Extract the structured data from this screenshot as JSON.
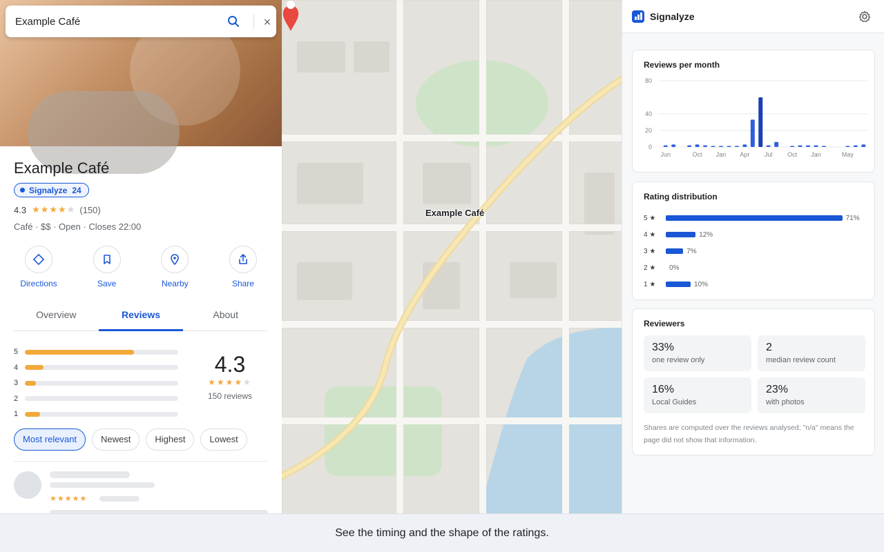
{
  "search": {
    "value": "Example Café",
    "icons": {
      "search": "search-icon",
      "close": "close-icon"
    }
  },
  "place": {
    "name": "Example Café",
    "badge": {
      "label": "Signalyze",
      "count": "24"
    },
    "rating": "4.3",
    "stars": 4,
    "rating_count": "(150)",
    "info": "Café · $$ · Open · Closes 22:00"
  },
  "actions": [
    {
      "label": "Directions",
      "icon": "directions-icon"
    },
    {
      "label": "Save",
      "icon": "bookmark-icon"
    },
    {
      "label": "Nearby",
      "icon": "location-pin-icon"
    },
    {
      "label": "Share",
      "icon": "share-icon"
    }
  ],
  "tabs": [
    {
      "label": "Overview",
      "active": false
    },
    {
      "label": "Reviews",
      "active": true
    },
    {
      "label": "About",
      "active": false
    }
  ],
  "reviews_summary": {
    "histogram": [
      {
        "label": "5",
        "fraction": 0.71
      },
      {
        "label": "4",
        "fraction": 0.12
      },
      {
        "label": "3",
        "fraction": 0.07
      },
      {
        "label": "2",
        "fraction": 0.0
      },
      {
        "label": "1",
        "fraction": 0.1
      }
    ],
    "score": "4.3",
    "stars": 4,
    "count_label": "150 reviews"
  },
  "sort_chips": [
    {
      "label": "Most relevant",
      "active": true
    },
    {
      "label": "Newest",
      "active": false
    },
    {
      "label": "Highest",
      "active": false
    },
    {
      "label": "Lowest",
      "active": false
    }
  ],
  "map": {
    "pin_label": "Example Café"
  },
  "extension": {
    "title": "Signalyze",
    "reviews_card_title": "Reviews per month",
    "distribution_title": "Rating distribution",
    "distribution": [
      {
        "label": "5 ★",
        "percent": 71,
        "pct_label": "71%"
      },
      {
        "label": "4 ★",
        "percent": 12,
        "pct_label": "12%"
      },
      {
        "label": "3 ★",
        "percent": 7,
        "pct_label": "7%"
      },
      {
        "label": "2 ★",
        "percent": 0,
        "pct_label": "0%"
      },
      {
        "label": "1 ★",
        "percent": 10,
        "pct_label": "10%"
      }
    ],
    "reviewers_title": "Reviewers",
    "stats": [
      {
        "value": "33%",
        "label": "one review only"
      },
      {
        "value": "2",
        "label": "median review count"
      },
      {
        "value": "16%",
        "label": "Local Guides"
      },
      {
        "value": "23%",
        "label": "with photos"
      }
    ],
    "footnote": "Shares are computed over the reviews analysed; \"n/a\" means the page did not show that information."
  },
  "chart_data": {
    "type": "bar",
    "title": "Reviews per month",
    "values": [
      2,
      3,
      0,
      2,
      3,
      2,
      1,
      1,
      1,
      1,
      3,
      33,
      60,
      2,
      6,
      0,
      1,
      2,
      2,
      2,
      1,
      0,
      0,
      1,
      2,
      3
    ],
    "highlight_index": 12,
    "x_tick_labels": [
      {
        "index": 0,
        "label": "Jun"
      },
      {
        "index": 4,
        "label": "Oct"
      },
      {
        "index": 7,
        "label": "Jan"
      },
      {
        "index": 10,
        "label": "Apr"
      },
      {
        "index": 13,
        "label": "Jul"
      },
      {
        "index": 16,
        "label": "Oct"
      },
      {
        "index": 19,
        "label": "Jan"
      },
      {
        "index": 23,
        "label": "May"
      }
    ],
    "y_ticks": [
      0,
      20,
      40,
      80
    ],
    "ylim": [
      0,
      80
    ],
    "grid": true,
    "colors": {
      "bar": "#2f5fe0",
      "highlight": "#1a3fb5"
    }
  },
  "caption": "See the timing and the shape of the ratings."
}
